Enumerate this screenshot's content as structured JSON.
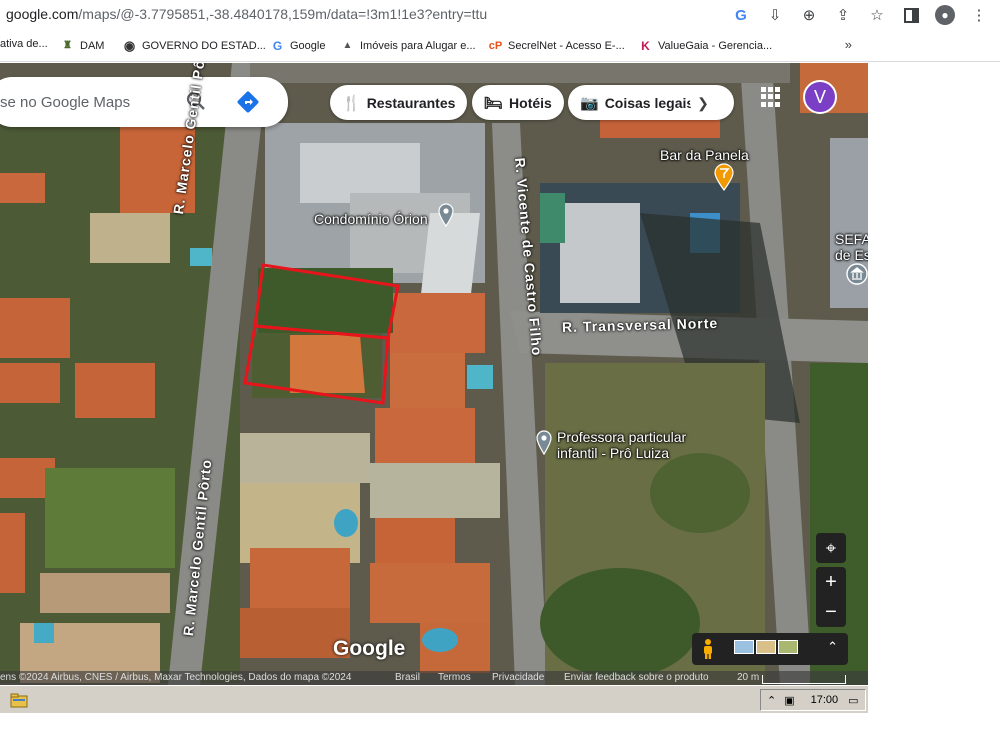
{
  "browser": {
    "url_host": "google.com",
    "url_rest": "/maps/@-3.7795851,-38.4840178,159m/data=!3m1!1e3?entry=ttu",
    "icons": [
      "google-g-icon",
      "install-app-icon",
      "zoom-icon",
      "share-icon",
      "star-icon",
      "sidebar-icon",
      "profile-icon",
      "menu-icon"
    ]
  },
  "bookmarks": [
    {
      "label": "ativa de...",
      "icon": "page-icon"
    },
    {
      "label": "DAM",
      "icon": "crest-icon"
    },
    {
      "label": "GOVERNO DO ESTAD...",
      "icon": "globe-icon"
    },
    {
      "label": "Google",
      "icon": "google-g-icon"
    },
    {
      "label": "Imóveis para Alugar e...",
      "icon": "house-icon"
    },
    {
      "label": "SecrelNet - Acesso E-...",
      "icon": "secrel-icon"
    },
    {
      "label": "ValueGaia - Gerencia...",
      "icon": "valuegaia-icon"
    }
  ],
  "bookmarks_more": "»",
  "maps": {
    "search_placeholder": "se no Google Maps",
    "chips": [
      {
        "label": "Restaurantes",
        "icon": "fork-knife-icon"
      },
      {
        "label": "Hotéis",
        "icon": "bed-icon"
      },
      {
        "label": "Coisas legais",
        "icon": "camera-icon"
      }
    ],
    "account_initial": "V",
    "places": {
      "orion": "Condomínio Órion",
      "bar": "Bar da Panela",
      "sefaz1": "SEFA",
      "sefaz2": "de Es",
      "teacher1": "Professora particular",
      "teacher2": "infantil - Prô Luiza"
    },
    "streets": {
      "marcelo_top": "R. Marcelo Gentil Pôrto",
      "marcelo_bottom": "R. Marcelo Gentil Pôrto",
      "vicente": "R. Vicente de Castro Filho",
      "transversal": "R. Transversal Norte"
    },
    "watermark": "Google",
    "footer": {
      "imagery": "ens ©2024 Airbus, CNES / Airbus, Maxar Technologies, Dados do mapa ©2024",
      "country": "Brasil",
      "terms": "Termos",
      "privacy": "Privacidade",
      "feedback": "Enviar feedback sobre o produto",
      "scale": "20 m"
    },
    "zoom_in": "+",
    "zoom_out": "−"
  },
  "taskbar": {
    "time": "17:00"
  },
  "colors": {
    "plot_outline": "#e8141b",
    "account_bg": "#7b3fc6",
    "directions_blue": "#1a73e8",
    "bar_pin": "#f29900"
  }
}
